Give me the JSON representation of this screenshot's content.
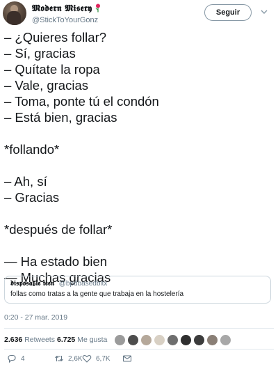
{
  "header": {
    "display_name": "𝕸𝖔𝖉𝖊𝖗𝖓 𝕸𝖎𝖘𝖊𝖗𝖞",
    "handle": "@StickToYourGonz",
    "follow_label": "Seguir"
  },
  "tweet": {
    "lines": [
      "– ¿Quieres follar?",
      "– Sí, gracias",
      "– Quítate la ropa",
      "– Vale, gracias",
      "– Toma, ponte tú el condón",
      "– Está bien, gracias",
      "",
      "*follando*",
      "",
      "– Ah, sí",
      "– Gracias",
      "",
      "*después de follar*",
      "",
      "— Ha estado bien",
      "— Muchas gracias"
    ]
  },
  "quote": {
    "display_name": "𝖉𝖎𝖘𝖕𝖔𝖘𝖆𝖇𝖑𝖊 𝖙𝖊𝖊𝖓",
    "handle": "@bpdbasedbitx",
    "text": "follas como tratas a la gente que trabaja en la hostelería"
  },
  "timestamp": "0:20 - 27 mar. 2019",
  "stats": {
    "retweets_count": "2.636",
    "retweets_label": "Retweets",
    "likes_count": "6.725",
    "likes_label": "Me gusta"
  },
  "actions": {
    "replies": "4",
    "retweets": "2,6K",
    "likes": "6,7K"
  },
  "colors": {
    "text": "#14171a",
    "secondary": "#657786",
    "border": "#ccd6dd"
  },
  "icons": [
    "rose-icon",
    "chevron-down-icon",
    "reply-icon",
    "retweet-icon",
    "heart-icon",
    "message-icon"
  ]
}
